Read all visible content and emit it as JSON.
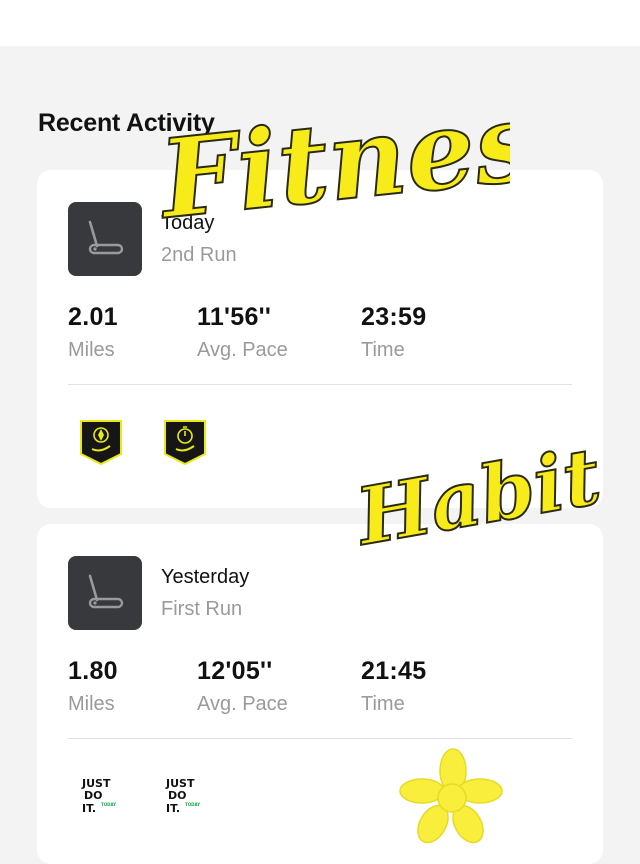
{
  "header": {
    "section_title": "Recent Activity"
  },
  "activities": [
    {
      "date": "Today",
      "name": "2nd Run",
      "icon": "treadmill-icon",
      "stats": [
        {
          "value": "2.01",
          "label": "Miles"
        },
        {
          "value": "11'56''",
          "label": "Avg. Pace"
        },
        {
          "value": "23:59",
          "label": "Time"
        }
      ],
      "badges": [
        "compass-badge-icon",
        "stopwatch-badge-icon"
      ]
    },
    {
      "date": "Yesterday",
      "name": "First Run",
      "icon": "treadmill-icon",
      "stats": [
        {
          "value": "1.80",
          "label": "Miles"
        },
        {
          "value": "12'05''",
          "label": "Avg. Pace"
        },
        {
          "value": "21:45",
          "label": "Time"
        }
      ],
      "badges": [
        "just-do-it-sticker",
        "just-do-it-sticker"
      ]
    }
  ],
  "overlay": {
    "word_one": "Fitness",
    "word_two": "Habits",
    "sticker_lines": [
      "JUST",
      "DO",
      "IT.",
      "TODAY"
    ]
  },
  "colors": {
    "overlay_yellow": "#f7ec1a",
    "badge_yellow": "#e7ea15",
    "card_bg": "#ffffff",
    "page_bg": "#f3f3f4"
  }
}
